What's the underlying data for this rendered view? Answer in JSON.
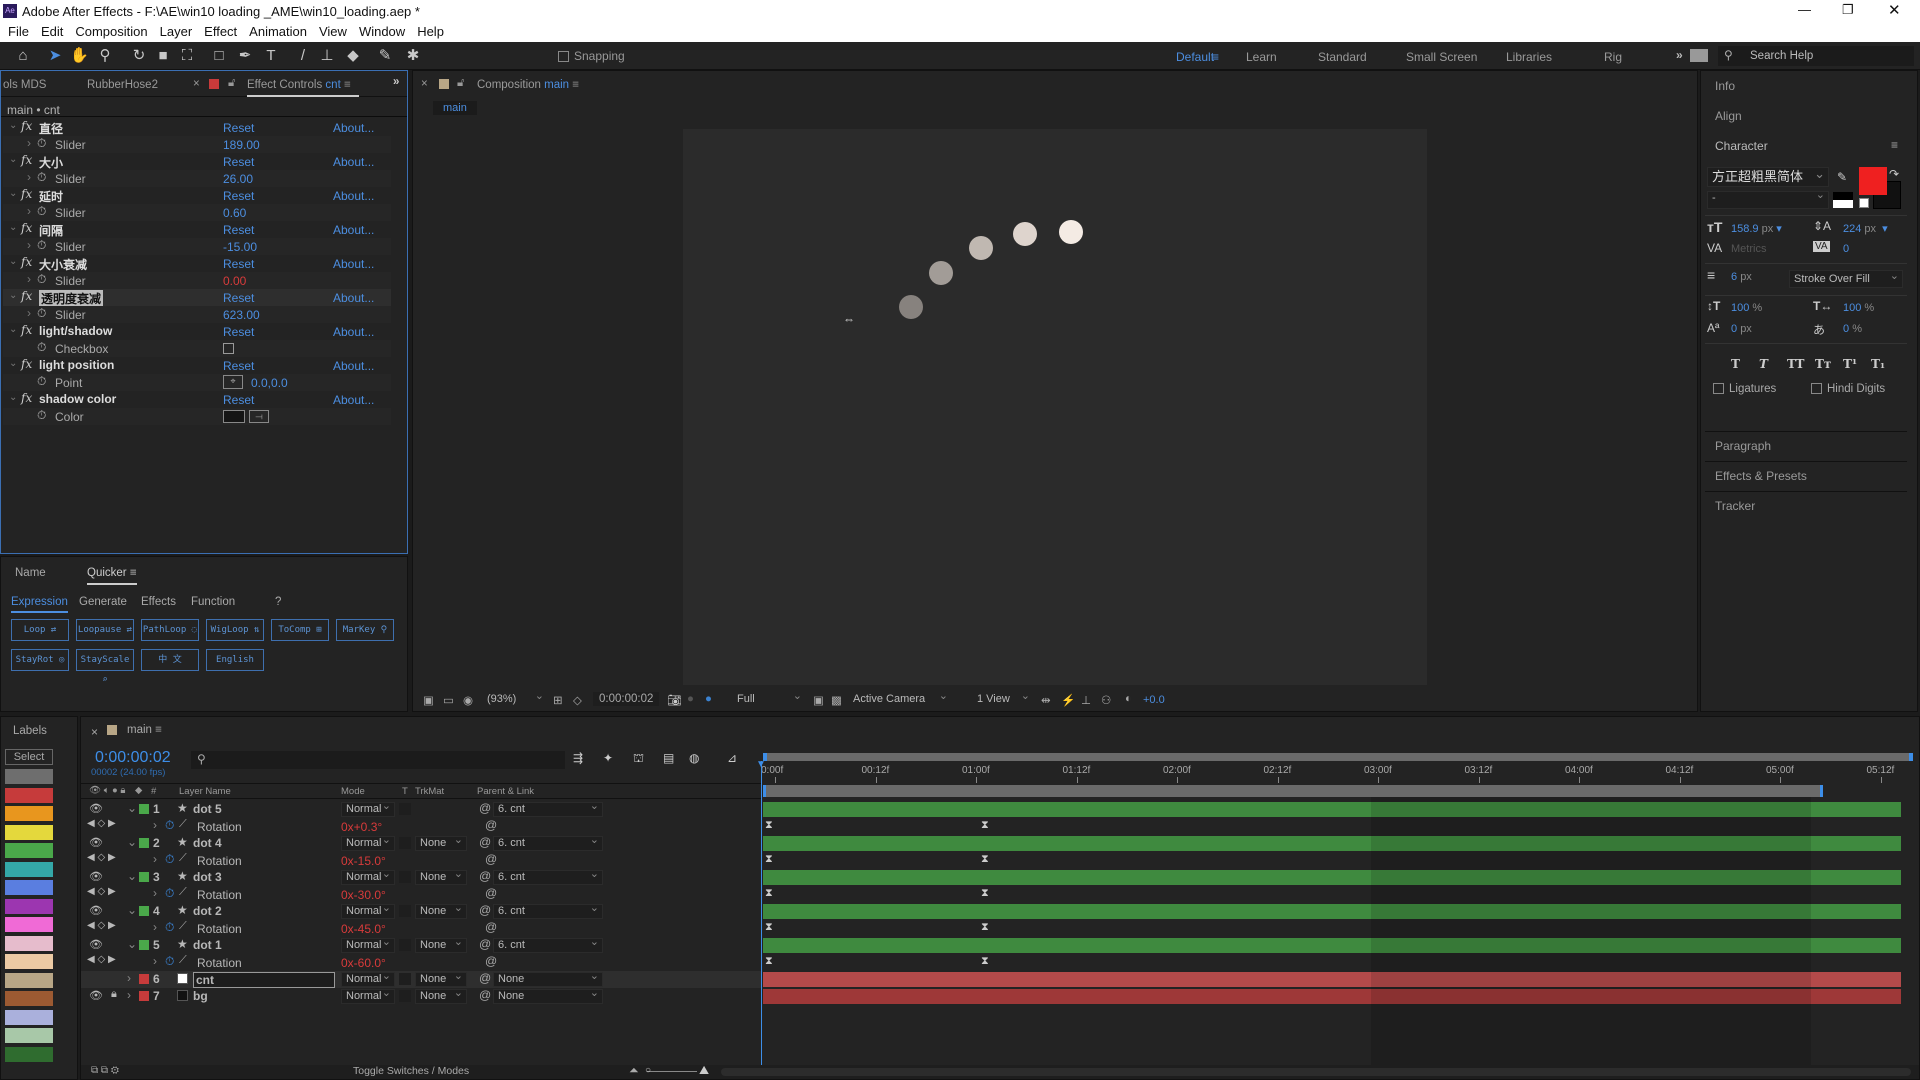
{
  "window": {
    "title": "Adobe After Effects - F:\\AE\\win10 loading _AME\\win10_loading.aep *",
    "app_icon": "Ae"
  },
  "menu": [
    "File",
    "Edit",
    "Composition",
    "Layer",
    "Effect",
    "Animation",
    "View",
    "Window",
    "Help"
  ],
  "toolbar": {
    "snapping": "Snapping",
    "workspaces": [
      "Default",
      "Learn",
      "Standard",
      "Small Screen",
      "Libraries",
      "Rig"
    ],
    "active_workspace": "Default",
    "search_placeholder": "Search Help"
  },
  "effect_panel": {
    "tabs": [
      "ols MDS",
      "RubberHose2"
    ],
    "active_tab": "Effect Controls",
    "active_layer": "cnt",
    "breadcrumb": "main • cnt",
    "effects": [
      {
        "name": "直径",
        "reset": "Reset",
        "about": "About...",
        "prop": "Slider",
        "value": "189.00",
        "value_color": "#4c8ee0"
      },
      {
        "name": "大小",
        "reset": "Reset",
        "about": "About...",
        "prop": "Slider",
        "value": "26.00",
        "value_color": "#4c8ee0"
      },
      {
        "name": "延时",
        "reset": "Reset",
        "about": "About...",
        "prop": "Slider",
        "value": "0.60",
        "value_color": "#4c8ee0"
      },
      {
        "name": "间隔",
        "reset": "Reset",
        "about": "About...",
        "prop": "Slider",
        "value": "-15.00",
        "value_color": "#4c8ee0"
      },
      {
        "name": "大小衰减",
        "reset": "Reset",
        "about": "About...",
        "prop": "Slider",
        "value": "0.00",
        "value_color": "#d83b3b"
      },
      {
        "name": "透明度衰减",
        "reset": "Reset",
        "about": "About...",
        "prop": "Slider",
        "value": "623.00",
        "value_color": "#4c8ee0",
        "selected": true
      },
      {
        "name": "light/shadow",
        "reset": "Reset",
        "about": "About...",
        "prop": "Checkbox",
        "value": "",
        "checked": false
      },
      {
        "name": "light position",
        "reset": "Reset",
        "about": "About...",
        "prop": "Point",
        "value": "0.0,0.0",
        "value_color": "#4c8ee0"
      },
      {
        "name": "shadow color",
        "reset": "Reset",
        "about": "About...",
        "prop": "Color",
        "value": "",
        "swatch": "#151515"
      }
    ]
  },
  "quicker": {
    "tabs": [
      "Name",
      "Quicker"
    ],
    "active_tab": "Quicker",
    "subtabs": [
      "Expression",
      "Generate",
      "Effects",
      "Function",
      "?"
    ],
    "active_subtab": "Expression",
    "buttons": [
      "Loop ⇄",
      "Loopause ⇄",
      "PathLoop ◌",
      "WigLoop ⇅",
      "ToComp ⊞",
      "MarKey ⚲",
      "StayRot ◎",
      "StayScale ⌕",
      "中  文",
      "English"
    ]
  },
  "composition": {
    "tab_label": "Composition",
    "comp_name": "main",
    "sub_tab": "main",
    "zoom": "(93%)",
    "timecode": "0:00:00:02",
    "resolution": "Full",
    "camera": "Active Camera",
    "views": "1 View",
    "exposure": "+0.0",
    "dot_colors": [
      "#f4ebe4",
      "#ded4cd",
      "#c0b8b1",
      "#a29c97",
      "#87827e"
    ]
  },
  "right_panel": {
    "info": "Info",
    "align": "Align",
    "character": "Character",
    "font": "方正超粗黑简体",
    "font_style": "-",
    "fill_color": "#ef2020",
    "size": "158.9",
    "size_unit": "px",
    "leading": "224",
    "leading_unit": "px",
    "kerning": "Metrics",
    "tracking": "0",
    "stroke_width": "6",
    "stroke_unit": "px",
    "stroke_type": "Stroke Over Fill",
    "vscale": "100",
    "hscale": "100",
    "pct": "%",
    "baseline": "0",
    "baseline_unit": "px",
    "tsume": "0",
    "styles": [
      "T",
      "T",
      "TT",
      "Tт",
      "T¹",
      "T₁"
    ],
    "ligatures": "Ligatures",
    "hindi_digits": "Hindi Digits",
    "paragraph": "Paragraph",
    "effects_presets": "Effects & Presets",
    "tracker": "Tracker"
  },
  "timeline": {
    "labels_title": "Labels",
    "select": "Select",
    "label_colors": [
      "#6e6e6e",
      "#c63b3b",
      "#e8961e",
      "#e4d83c",
      "#4aa84a",
      "#34a8a8",
      "#5a7ee0",
      "#9c36b0",
      "#f06ad6",
      "#e6bccc",
      "#eccaa4",
      "#b8a686",
      "#9c5a32",
      "#aab0dc",
      "#a8c8a8",
      "#2f6c2f"
    ],
    "comp_tab": "main",
    "timecode": "0:00:00:02",
    "frame_info": "00002 (24.00 fps)",
    "columns": {
      "layer_name": "Layer Name",
      "mode": "Mode",
      "t": "T",
      "trkmat": "TrkMat",
      "parent": "Parent & Link",
      "num": "#"
    },
    "layers": [
      {
        "num": "1",
        "name": "dot 5",
        "mode": "Normal",
        "trkmat": "",
        "parent": "6. cnt",
        "label": "#4aa84a",
        "prop": "Rotation",
        "prop_value": "0x+0.3°",
        "bar": "#3f8a3f"
      },
      {
        "num": "2",
        "name": "dot 4",
        "mode": "Normal",
        "trkmat": "None",
        "parent": "6. cnt",
        "label": "#4aa84a",
        "prop": "Rotation",
        "prop_value": "0x-15.0°",
        "bar": "#3f8a3f"
      },
      {
        "num": "3",
        "name": "dot 3",
        "mode": "Normal",
        "trkmat": "None",
        "parent": "6. cnt",
        "label": "#4aa84a",
        "prop": "Rotation",
        "prop_value": "0x-30.0°",
        "bar": "#3f8a3f"
      },
      {
        "num": "4",
        "name": "dot 2",
        "mode": "Normal",
        "trkmat": "None",
        "parent": "6. cnt",
        "label": "#4aa84a",
        "prop": "Rotation",
        "prop_value": "0x-45.0°",
        "bar": "#3f8a3f"
      },
      {
        "num": "5",
        "name": "dot 1",
        "mode": "Normal",
        "trkmat": "None",
        "parent": "6. cnt",
        "label": "#4aa84a",
        "prop": "Rotation",
        "prop_value": "0x-60.0°",
        "bar": "#3f8a3f"
      },
      {
        "num": "6",
        "name": "cnt",
        "mode": "Normal",
        "trkmat": "None",
        "parent": "None",
        "label": "#c63b3b",
        "bar": "#b44a4a",
        "selected": true
      },
      {
        "num": "7",
        "name": "bg",
        "mode": "Normal",
        "trkmat": "None",
        "parent": "None",
        "label": "#c63b3b",
        "bar": "#9e3838",
        "locked": true
      }
    ],
    "ruler": [
      "0:00f",
      "00:12f",
      "01:00f",
      "01:12f",
      "02:00f",
      "02:12f",
      "03:00f",
      "03:12f",
      "04:00f",
      "04:12f",
      "05:00f",
      "05:12f"
    ],
    "toggle_label": "Toggle Switches / Modes"
  }
}
